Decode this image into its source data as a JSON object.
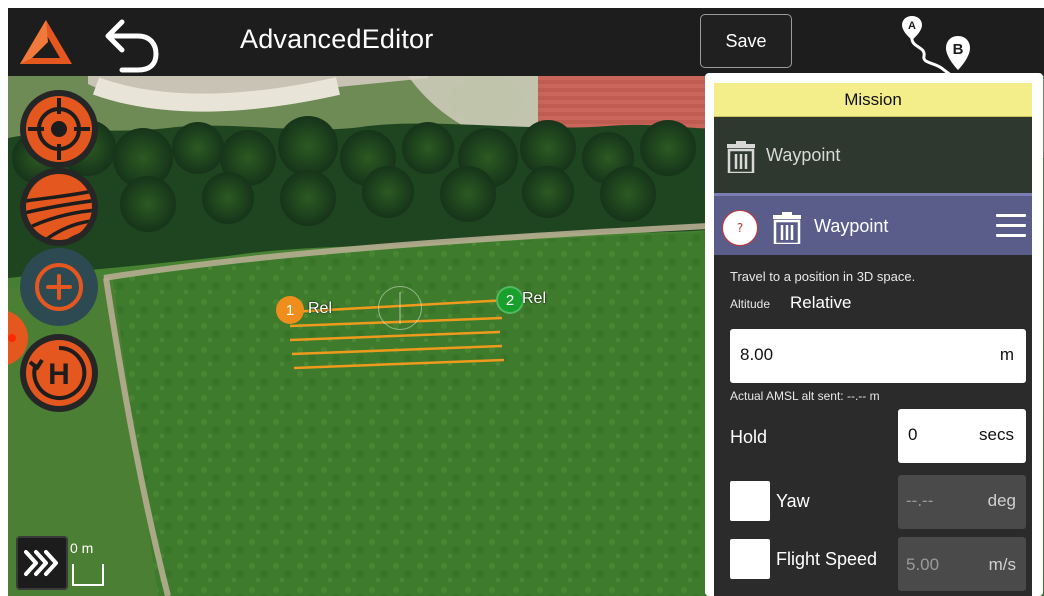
{
  "header": {
    "title": "AdvancedEditor",
    "save_label": "Save",
    "route_start_label": "A",
    "route_end_label": "B"
  },
  "map": {
    "scale_label": "0 m",
    "waypoints": [
      {
        "number": "1",
        "label": "Rel"
      },
      {
        "number": "2",
        "label": "Rel"
      }
    ]
  },
  "mission": {
    "header_label": "Mission",
    "previous_item_label": "Waypoint",
    "current_item": {
      "help_label": "?",
      "title": "Waypoint",
      "description": "Travel to a position in 3D space.",
      "altitude_label": "Altitude",
      "altitude_mode": "Relative",
      "altitude_value": "8.00",
      "altitude_unit": "m",
      "amsl_note": "Actual AMSL alt sent: --.-- m",
      "hold_label": "Hold",
      "hold_value": "0",
      "hold_unit": "secs",
      "yaw_label": "Yaw",
      "yaw_value": "--.--",
      "yaw_unit": "deg",
      "speed_label": "Flight Speed",
      "speed_value": "5.00",
      "speed_unit": "m/s"
    }
  },
  "colors": {
    "accent_orange": "#e4571f",
    "waypoint_1": "#ef8e1c",
    "waypoint_2": "#19a02c",
    "mission_header": "#f3ee8a",
    "card_header": "#5a5d8a"
  },
  "icons": {
    "logo": "app-logo-icon",
    "back": "back-arrow-icon",
    "route": "route-ab-icon",
    "target": "crosshair-icon",
    "survey": "survey-pattern-icon",
    "add": "add-waypoint-icon",
    "home": "return-home-icon",
    "expand": "chevrons-right-icon",
    "trash": "trash-icon",
    "menu": "hamburger-menu-icon"
  }
}
